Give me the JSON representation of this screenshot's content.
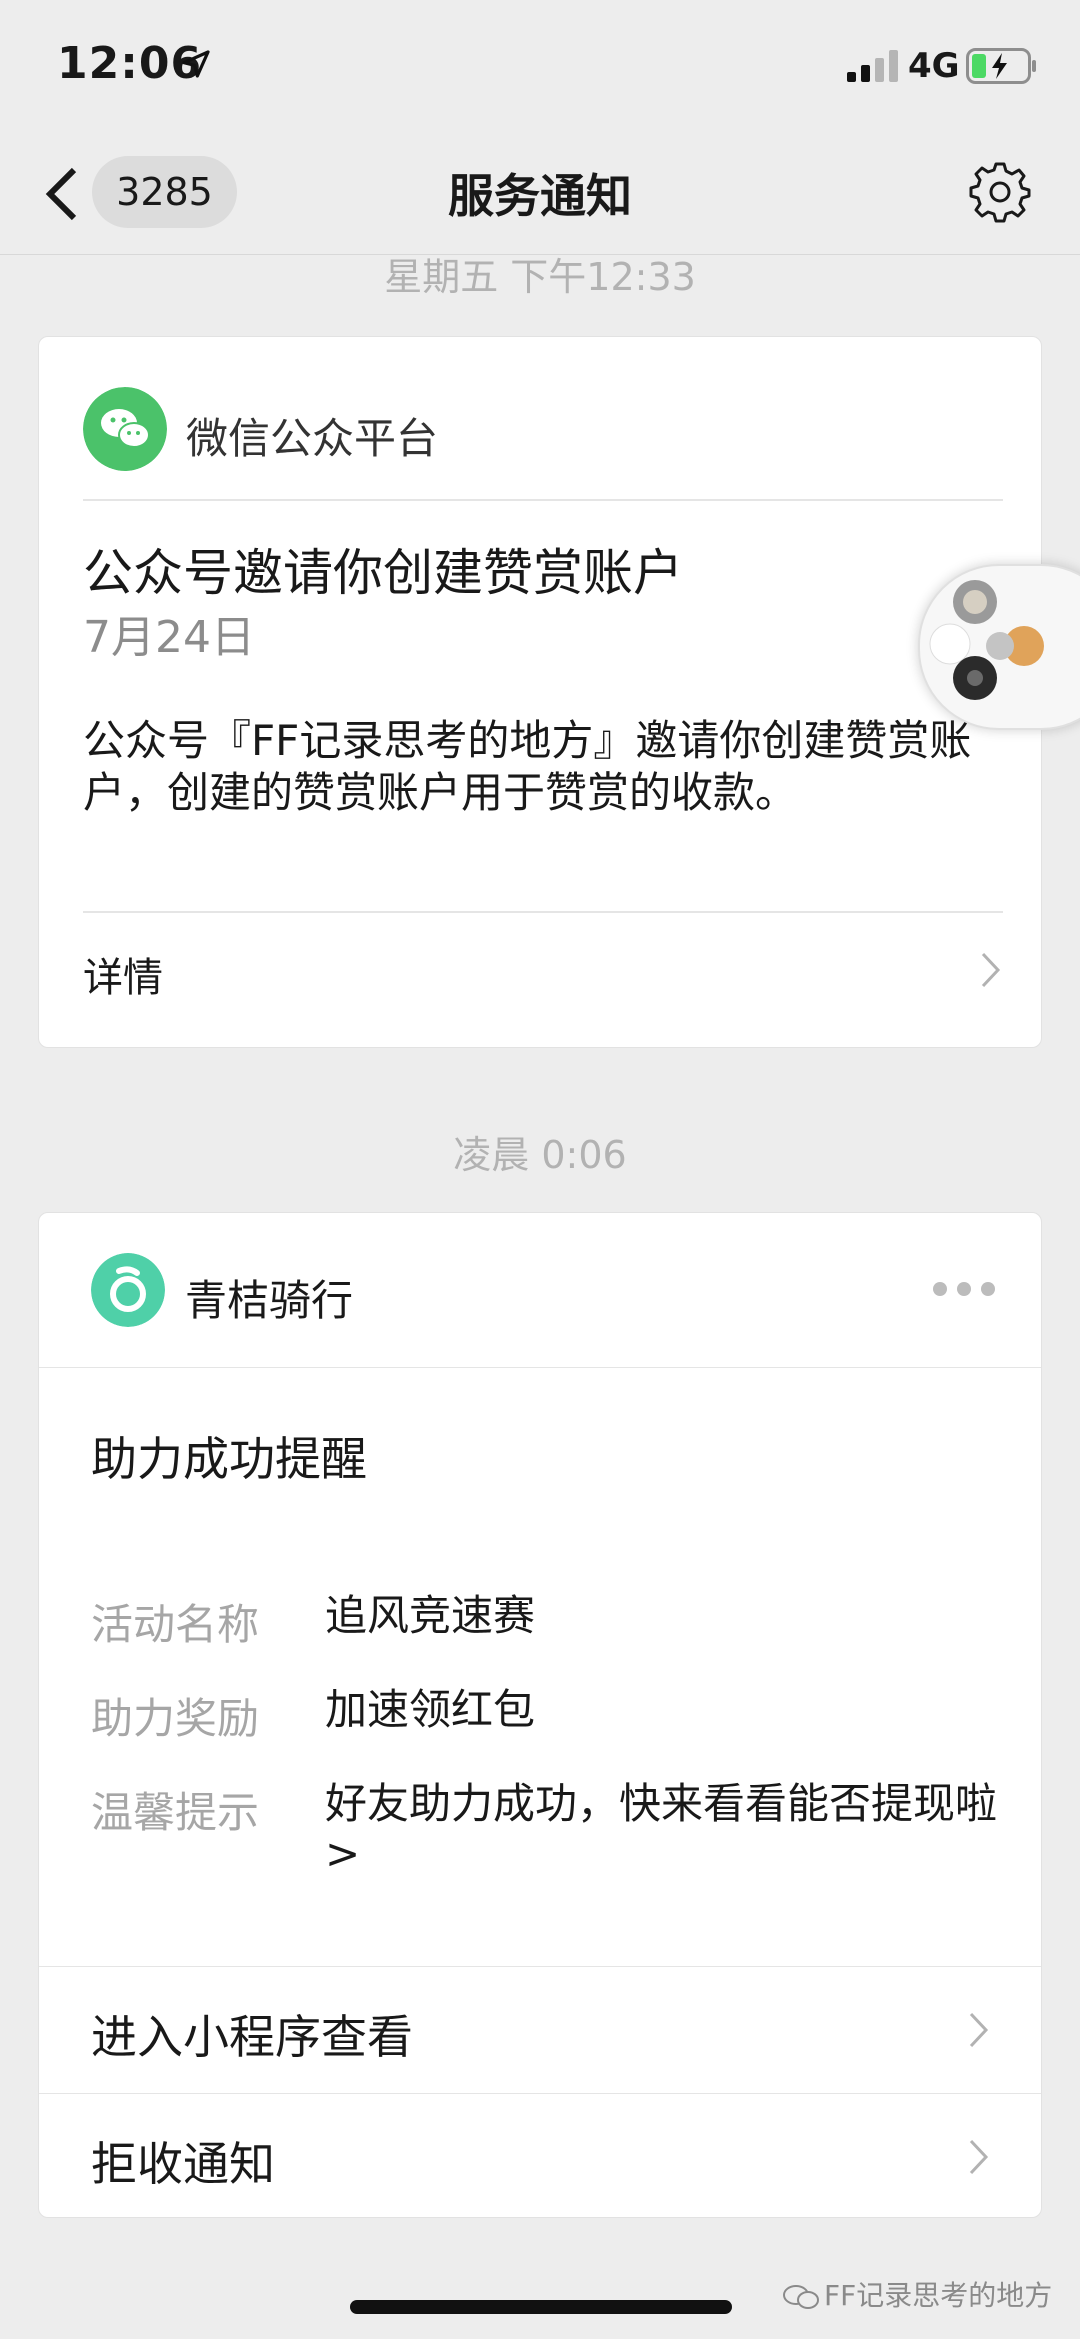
{
  "status_bar": {
    "time": "12:06",
    "network": "4G",
    "icons": [
      "location-arrow-icon",
      "signal-icon",
      "battery-charging-icon"
    ]
  },
  "nav": {
    "back_badge": "3285",
    "title": "服务通知",
    "icons": [
      "back-chevron-icon",
      "gear-icon"
    ]
  },
  "messages": [
    {
      "time_separator": "星期五 下午12:33",
      "source": "微信公众平台",
      "title": "公众号邀请你创建赞赏账户",
      "date": "7月24日",
      "body": "公众号『FF记录思考的地方』邀请你创建赞赏账户，创建的赞赏账户用于赞赏的收款。",
      "detail_label": "详情",
      "logo_icon": "wechat-icon",
      "logo_color": "#4bc26a"
    },
    {
      "time_separator": "凌晨 0:06",
      "source": "青桔骑行",
      "title": "助力成功提醒",
      "logo_icon": "qingju-logo-icon",
      "logo_color": "#4fd0a8",
      "fields": [
        {
          "key": "活动名称",
          "value": "追风竞速赛"
        },
        {
          "key": "助力奖励",
          "value": "加速领红包"
        },
        {
          "key": "温馨提示",
          "value": "好友助力成功，快来看看能否提现啦>"
        }
      ],
      "actions": [
        "进入小程序查看",
        "拒收通知"
      ]
    }
  ],
  "watermark": "FF记录思考的地方"
}
